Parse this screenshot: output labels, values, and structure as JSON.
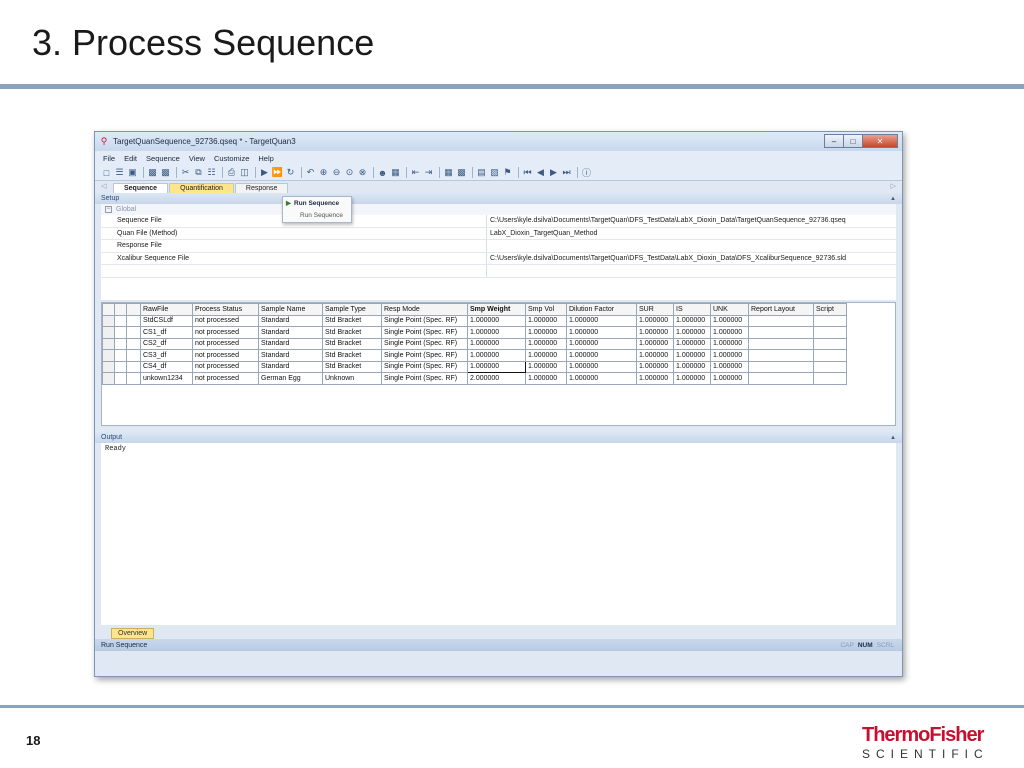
{
  "slide": {
    "title": "3. Process Sequence",
    "number": "18",
    "logo_main": "ThermoFisher",
    "logo_sub": "SCIENTIFIC"
  },
  "window": {
    "title": "TargetQuanSequence_92736.qseq * - TargetQuan3",
    "controls": [
      "–",
      "□",
      "✕"
    ]
  },
  "menu": [
    "File",
    "Edit",
    "Sequence",
    "View",
    "Customize",
    "Help"
  ],
  "tabs": [
    {
      "label": "Sequence",
      "state": "active"
    },
    {
      "label": "Quantification",
      "state": "yellow"
    },
    {
      "label": "Response",
      "state": "normal"
    }
  ],
  "popup": {
    "item1": "Run Sequence",
    "item2": "Run Sequence"
  },
  "setup": {
    "header": "Setup",
    "group": "Global",
    "rows": [
      {
        "key": "Sequence File",
        "value": "C:\\Users\\kyle.dsilva\\Documents\\TargetQuan\\DFS_TestData\\LabX_Dioxin_Data\\TargetQuanSequence_92736.qseq"
      },
      {
        "key": "Quan File (Method)",
        "value": "LabX_Dioxin_TargetQuan_Method"
      },
      {
        "key": "Response File",
        "value": ""
      },
      {
        "key": "Xcalibur Sequence File",
        "value": "C:\\Users\\kyle.dsilva\\Documents\\TargetQuan\\DFS_TestData\\LabX_Dioxin_Data\\DFS_XcaliburSequence_92736.sld"
      }
    ]
  },
  "grid": {
    "columns": [
      "RawFile",
      "Process Status",
      "Sample Name",
      "Sample Type",
      "Resp Mode",
      "Smp Weight",
      "Smp Vol",
      "Dilution Factor",
      "SUR",
      "IS",
      "UNK",
      "Report Layout",
      "Script"
    ],
    "rows": [
      [
        "StdCSLdf",
        "not processed",
        "Standard",
        "Std Bracket",
        "Single Point (Spec. RF)",
        "1.000000",
        "1.000000",
        "1.000000",
        "1.000000",
        "1.000000",
        "1.000000",
        "",
        ""
      ],
      [
        "CS1_df",
        "not processed",
        "Standard",
        "Std Bracket",
        "Single Point (Spec. RF)",
        "1.000000",
        "1.000000",
        "1.000000",
        "1.000000",
        "1.000000",
        "1.000000",
        "",
        ""
      ],
      [
        "CS2_df",
        "not processed",
        "Standard",
        "Std Bracket",
        "Single Point (Spec. RF)",
        "1.000000",
        "1.000000",
        "1.000000",
        "1.000000",
        "1.000000",
        "1.000000",
        "",
        ""
      ],
      [
        "CS3_df",
        "not processed",
        "Standard",
        "Std Bracket",
        "Single Point (Spec. RF)",
        "1.000000",
        "1.000000",
        "1.000000",
        "1.000000",
        "1.000000",
        "1.000000",
        "",
        ""
      ],
      [
        "CS4_df",
        "not processed",
        "Standard",
        "Std Bracket",
        "Single Point (Spec. RF)",
        "1.000000",
        "1.000000",
        "1.000000",
        "1.000000",
        "1.000000",
        "1.000000",
        "",
        ""
      ],
      [
        "unkown1234",
        "not processed",
        "German Egg",
        "Unknown",
        "Single Point (Spec. RF)",
        "2.000000",
        "1.000000",
        "1.000000",
        "1.000000",
        "1.000000",
        "1.000000",
        "",
        ""
      ]
    ]
  },
  "output": {
    "header": "Output",
    "text": "Ready"
  },
  "overview_tab": "Overview",
  "status": {
    "text": "Run Sequence",
    "flags": [
      {
        "label": "CAP",
        "on": false
      },
      {
        "label": "NUM",
        "on": true
      },
      {
        "label": "SCRL",
        "on": false
      }
    ]
  },
  "colors": {
    "accent_rule": "#8aa4bf",
    "brand_red": "#c8102e",
    "tab_yellow": "#ffe58a"
  },
  "icons": [
    "magnifier-icon",
    "new-icon",
    "open-icon",
    "save-icon",
    "cut-icon",
    "copy-icon",
    "paste-icon",
    "print-icon",
    "run-icon",
    "undo-icon",
    "help-icon"
  ]
}
